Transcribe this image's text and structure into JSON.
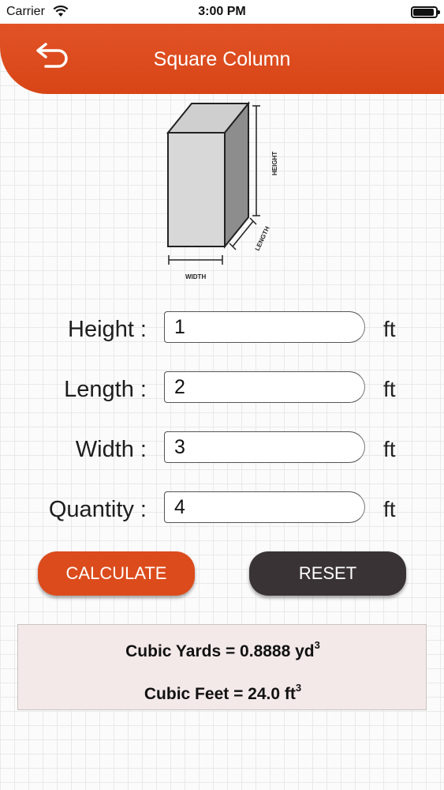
{
  "status_bar": {
    "carrier": "Carrier",
    "time": "3:00 PM"
  },
  "header": {
    "title": "Square Column",
    "back_icon": "back-arrow-icon",
    "color": "#dc4b1c"
  },
  "diagram": {
    "height_label": "HEIGHT",
    "length_label": "LENGTH",
    "width_label": "WIDTH"
  },
  "form": {
    "fields": [
      {
        "label": "Height :",
        "value": "1",
        "unit": "ft"
      },
      {
        "label": "Length :",
        "value": "2",
        "unit": "ft"
      },
      {
        "label": "Width :",
        "value": "3",
        "unit": "ft"
      },
      {
        "label": "Quantity :",
        "value": "4",
        "unit": "ft"
      }
    ]
  },
  "buttons": {
    "calculate": "CALCULATE",
    "reset": "RESET",
    "calculate_color": "#dc4b1c",
    "reset_color": "#3a3335"
  },
  "results": {
    "cubic_yards_text": "Cubic Yards = 0.8888 yd",
    "cubic_feet_text": "Cubic Feet = 24.0 ft",
    "exponent": "3"
  }
}
